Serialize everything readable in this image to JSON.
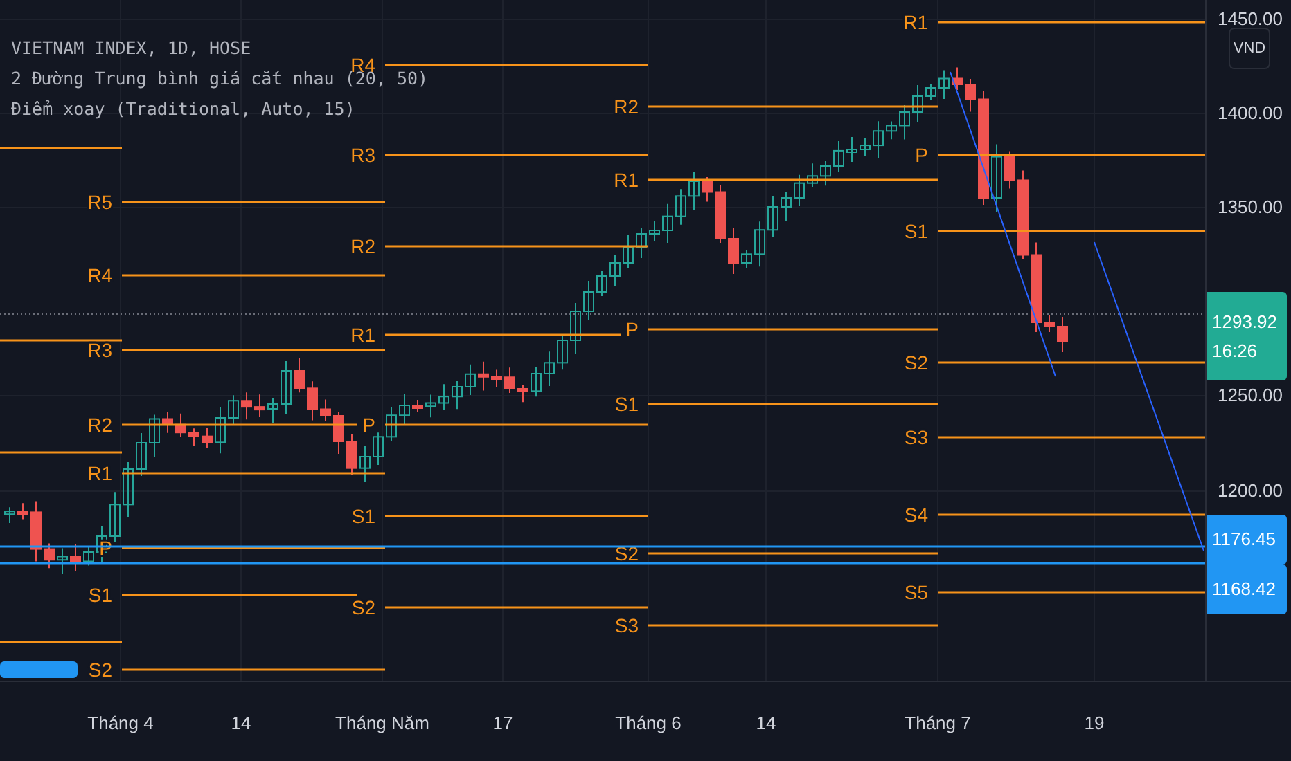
{
  "legend": [
    "VIETNAM INDEX, 1D, HOSE",
    "2 Đường Trung bình giá cắt nhau (20, 50)",
    "Điểm xoay (Traditional, Auto, 15)"
  ],
  "pivot_periods": [
    {
      "labels": [
        "R5",
        "R4",
        "R3",
        "R2",
        "R1",
        "P",
        "S1",
        "S2"
      ]
    },
    {
      "labels": [
        "R4",
        "R3",
        "R2",
        "R1",
        "P",
        "S1",
        "S2"
      ]
    },
    {
      "labels": [
        "R2",
        "R1",
        "P",
        "S1",
        "S2",
        "S3"
      ]
    },
    {
      "labels": [
        "R1",
        "P",
        "S1",
        "S2",
        "S3",
        "S4",
        "S5"
      ]
    }
  ],
  "price_axis": {
    "currency": "VND",
    "ticks": [
      "1450.00",
      "1400.00",
      "1350.00",
      "1250.00",
      "1200.00"
    ]
  },
  "last_price": {
    "value": "1293.92",
    "countdown": "16:26"
  },
  "price_labels": [
    "1176.45",
    "1168.42"
  ],
  "time_axis": [
    "Tháng 4",
    "14",
    "Tháng Năm",
    "17",
    "Tháng 6",
    "14",
    "Tháng 7",
    "19"
  ]
}
